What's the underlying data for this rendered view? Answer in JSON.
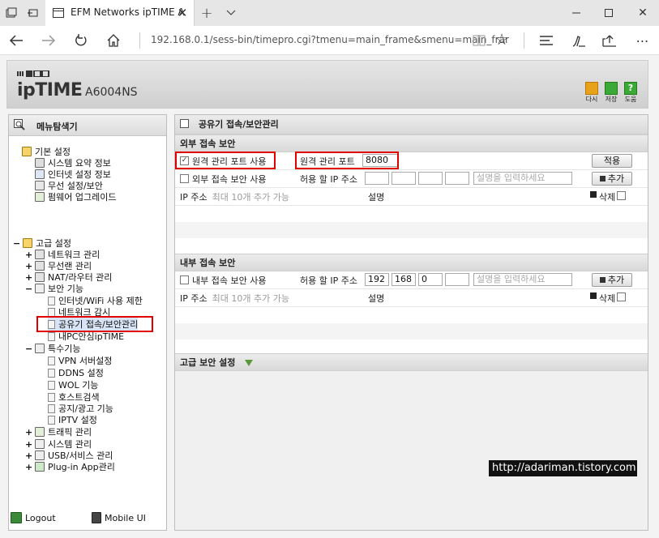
{
  "browser": {
    "tab_title": "EFM Networks ipTIME A",
    "url": "192.168.0.1/sess-bin/timepro.cgi?tmenu=main_frame&smenu=main_frar"
  },
  "header": {
    "logo_text": "ipTIME",
    "model": "A6004NS",
    "actions": [
      {
        "label": "다시",
        "color": "#e8a21a"
      },
      {
        "label": "저장",
        "color": "#3aa935"
      },
      {
        "label": "도움",
        "color": "#3aa935"
      }
    ]
  },
  "sidebar": {
    "title": "메뉴탐색기",
    "basic": {
      "label": "기본 설정",
      "items": [
        "시스템 요약 정보",
        "인터넷 설정 정보",
        "무선 설정/보안",
        "펌웨어 업그레이드"
      ]
    },
    "advanced": {
      "label": "고급 설정",
      "groups": [
        "네트워크 관리",
        "무선랜 관리",
        "NAT/라우터 관리"
      ],
      "security": {
        "label": "보안 기능",
        "items": [
          "인터넷/WiFi 사용 제한",
          "네트워크 감시",
          "공유기 접속/보안관리",
          "내PC안심ipTIME"
        ]
      },
      "special": {
        "label": "특수기능",
        "items": [
          "VPN 서버설정",
          "DDNS 설정",
          "WOL 기능",
          "호스트검색",
          "공지/광고 기능",
          "IPTV 설정"
        ]
      },
      "more": [
        "트래픽 관리",
        "시스템 관리",
        "USB/서비스 관리",
        "Plug-in App관리"
      ]
    },
    "logout": "Logout",
    "mobile": "Mobile UI"
  },
  "main": {
    "title": "공유기 접속/보안관리",
    "external": {
      "title": "외부 접속 보안",
      "remote_port_checkbox": "원격 관리 포트 사용",
      "remote_port_checked": true,
      "remote_port_label": "원격 관리 포트",
      "remote_port_value": "8080",
      "apply_button": "적용",
      "access_checkbox": "외부 접속 보안 사용",
      "allow_ip_label": "허용 할 IP 주소",
      "ip_octets": [
        "",
        "",
        "",
        ""
      ],
      "desc_placeholder": "설명을 입력하세요",
      "add_button": "추가",
      "list_ip_header": "IP 주소",
      "list_ip_note": "최대 10개 추가 가능",
      "list_desc_header": "설명",
      "delete_label": "삭제"
    },
    "internal": {
      "title": "내부 접속 보안",
      "access_checkbox": "내부 접속 보안 사용",
      "allow_ip_label": "허용 할 IP 주소",
      "ip_octets": [
        "192",
        "168",
        "0",
        ""
      ],
      "desc_placeholder": "설명을 입력하세요",
      "add_button": "추가",
      "list_ip_header": "IP 주소",
      "list_ip_note": "최대 10개 추가 가능",
      "list_desc_header": "설명",
      "delete_label": "삭제"
    },
    "advanced_title": "고급 보안 설정"
  },
  "watermark": "http://adariman.tistory.com"
}
